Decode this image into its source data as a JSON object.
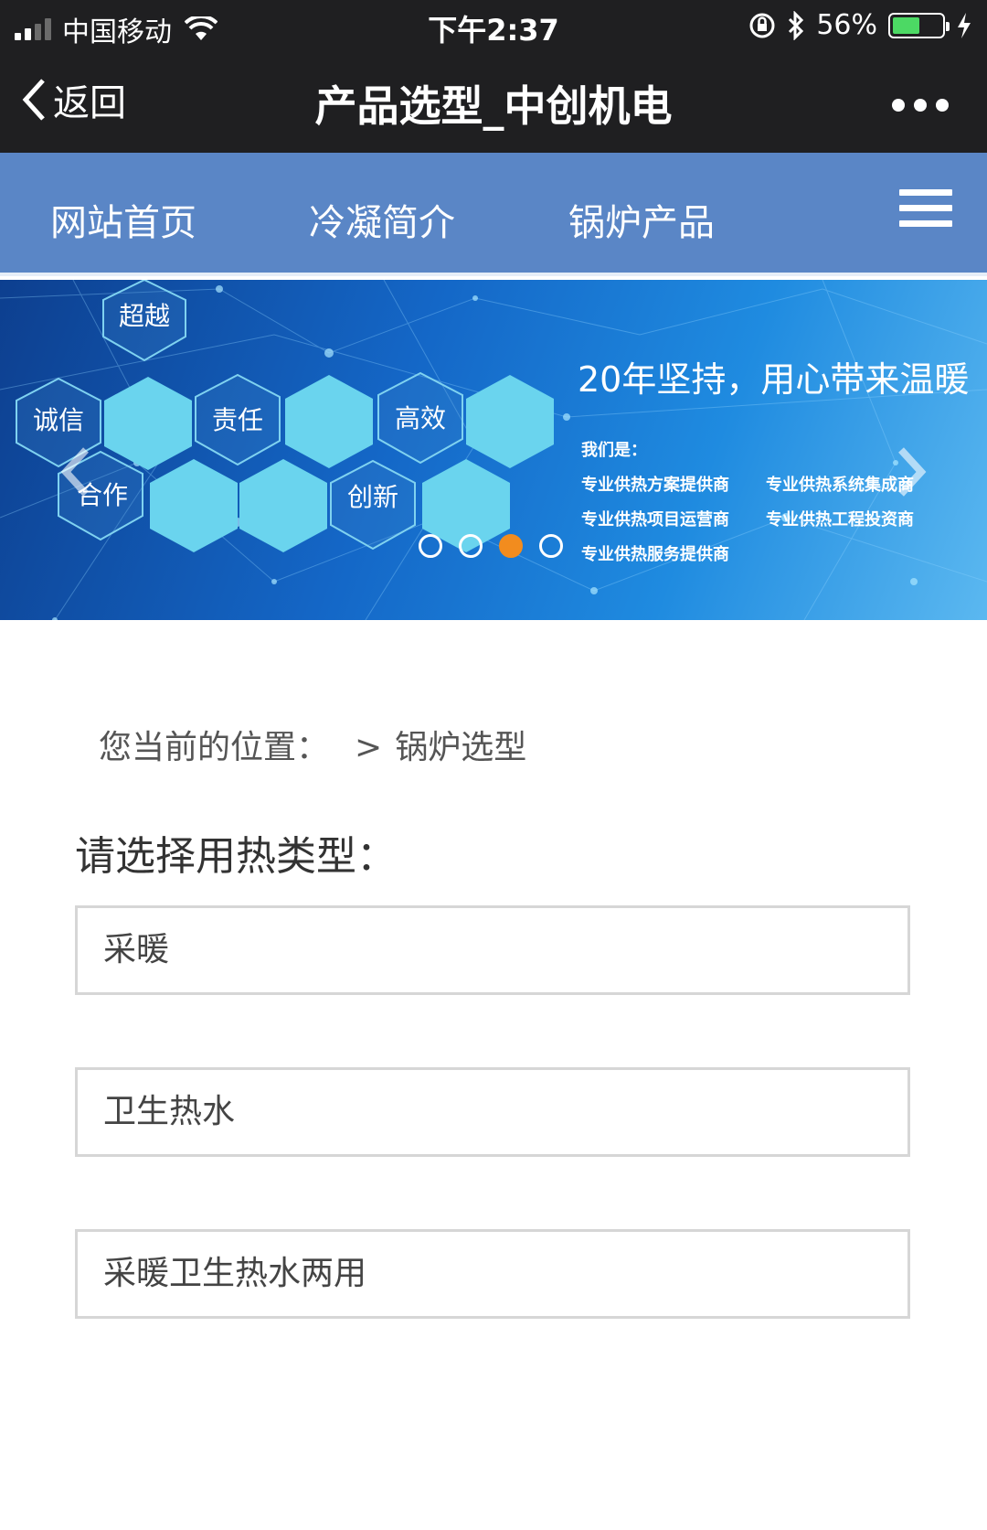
{
  "status_bar": {
    "carrier": "中国移动",
    "time": "下午2:37",
    "battery_percent": "56%",
    "battery_level": 0.56
  },
  "title_bar": {
    "back_label": "返回",
    "title": "产品选型_中创机电"
  },
  "nav": {
    "items": [
      {
        "label": "网站首页"
      },
      {
        "label": "冷凝简介"
      },
      {
        "label": "锅炉产品"
      }
    ]
  },
  "banner": {
    "hex_labels": [
      "超越",
      "诚信",
      "责任",
      "高效",
      "合作",
      "创新"
    ],
    "slogan": "20年坚持，用心带来温暖",
    "intro": "我们是：",
    "features": [
      "专业供热方案提供商",
      "专业供热系统集成商",
      "专业供热项目运营商",
      "专业供热工程投资商",
      "专业供热服务提供商"
    ],
    "slide_count": 4,
    "active_slide": 3
  },
  "breadcrumb": {
    "prefix": "您当前的位置：",
    "separator": ">",
    "current": "锅炉选型"
  },
  "selection": {
    "title": "请选择用热类型：",
    "options": [
      {
        "label": "采暖"
      },
      {
        "label": "卫生热水"
      },
      {
        "label": "采暖卫生热水两用"
      }
    ]
  },
  "colors": {
    "topbar": "#1f1f21",
    "nav": "#5a86c6",
    "active_dot": "#f28c1e",
    "battery": "#4cd964"
  }
}
